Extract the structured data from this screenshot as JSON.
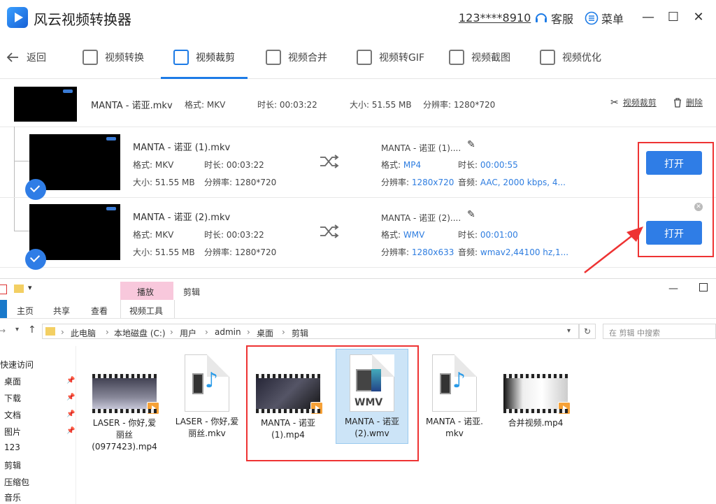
{
  "app": {
    "title": "风云视频转换器",
    "phone": "123****8910",
    "service_label": "客服",
    "menu_label": "菜单",
    "controls": {
      "minimize": "—",
      "maximize": "☐",
      "close": "✕"
    }
  },
  "nav": {
    "back_label": "返回",
    "items": [
      {
        "label": "视频转换",
        "icon": "convert-icon"
      },
      {
        "label": "视频裁剪",
        "icon": "crop-icon",
        "active": true
      },
      {
        "label": "视频合并",
        "icon": "merge-icon"
      },
      {
        "label": "视频转GIF",
        "icon": "gif-icon"
      },
      {
        "label": "视频截图",
        "icon": "screenshot-icon"
      },
      {
        "label": "视频优化",
        "icon": "optimize-icon"
      }
    ]
  },
  "source": {
    "name": "MANTA - 诺亚.mkv",
    "format": "格式: MKV",
    "duration": "时长: 00:03:22",
    "size": "大小: 51.55 MB",
    "resolution": "分辨率: 1280*720",
    "crop_label": "视频裁剪",
    "delete_label": "删除"
  },
  "clips": [
    {
      "src_name": "MANTA - 诺亚 (1).mkv",
      "src_format": "格式: MKV",
      "src_duration": "时长: 00:03:22",
      "src_size": "大小: 51.55 MB",
      "src_resolution": "分辨率: 1280*720",
      "out_name": "MANTA - 诺亚 (1)....",
      "format_label": "格式:",
      "out_format": "MP4",
      "duration_label": "时长:",
      "out_duration": "00:00:55",
      "resolution_label": "分辨率:",
      "out_resolution": "1280x720",
      "audio_label": "音频:",
      "out_audio": "AAC, 2000 kbps, 4...",
      "open_label": "打开"
    },
    {
      "src_name": "MANTA - 诺亚 (2).mkv",
      "src_format": "格式: MKV",
      "src_duration": "时长: 00:03:22",
      "src_size": "大小: 51.55 MB",
      "src_resolution": "分辨率: 1280*720",
      "out_name": "MANTA - 诺亚 (2)....",
      "format_label": "格式:",
      "out_format": "WMV",
      "duration_label": "时长:",
      "out_duration": "00:01:00",
      "resolution_label": "分辨率:",
      "out_resolution": "1280x633",
      "audio_label": "音频:",
      "out_audio": "wmav2,44100 hz,1...",
      "open_label": "打开"
    }
  ],
  "explorer": {
    "ribbon_context": "播放",
    "ribbon_context_sub": "视频工具",
    "window_title": "剪辑",
    "tabs": [
      "主页",
      "共享",
      "查看"
    ],
    "breadcrumb": [
      "此电脑",
      "本地磁盘 (C:)",
      "用户",
      "admin",
      "桌面",
      "剪辑"
    ],
    "search_placeholder": "在 剪辑 中搜索",
    "sidebar": [
      "快速访问",
      "桌面",
      "下载",
      "文档",
      "图片",
      "123",
      "剪辑",
      "压缩包",
      "音乐"
    ],
    "files": [
      {
        "label1": "LASER - 你好,爱",
        "label2": "丽丝",
        "label3": "(0977423).mp4",
        "kind": "video-thumb"
      },
      {
        "label1": "LASER - 你好,爱",
        "label2": "丽丝.mkv",
        "label3": "",
        "kind": "media-doc"
      },
      {
        "label1": "MANTA - 诺亚",
        "label2": "(1).mp4",
        "label3": "",
        "kind": "video-thumb"
      },
      {
        "label1": "MANTA - 诺亚",
        "label2": "(2).wmv",
        "label3": "",
        "kind": "wmv-doc",
        "badge": "WMV"
      },
      {
        "label1": "MANTA - 诺亚.",
        "label2": "mkv",
        "label3": "",
        "kind": "media-doc"
      },
      {
        "label1": "合并视频.mp4",
        "label2": "",
        "label3": "",
        "kind": "video-thumb-light"
      }
    ]
  },
  "colors": {
    "accent": "#2f7de6",
    "highlight": "#e33333",
    "ribbon_tab": "#f8c8dc",
    "selected_file": "#cce4f7"
  }
}
